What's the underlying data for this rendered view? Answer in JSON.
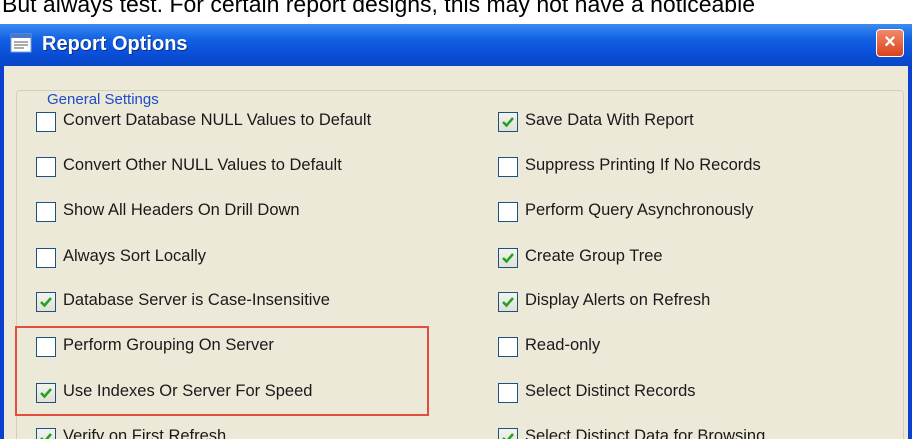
{
  "caption": "But always test.  For certain report designs, this may not have a noticeable",
  "window": {
    "title": "Report Options",
    "close_label": "×"
  },
  "group": {
    "title": "General Settings"
  },
  "options": {
    "left": [
      {
        "label": "Convert Database NULL Values to Default",
        "checked": false
      },
      {
        "label": "Convert Other NULL Values to Default",
        "checked": false
      },
      {
        "label": "Show All Headers On Drill Down",
        "checked": false
      },
      {
        "label": "Always Sort Locally",
        "checked": false
      },
      {
        "label": "Database Server is Case-Insensitive",
        "checked": true
      },
      {
        "label": "Perform Grouping On Server",
        "checked": false
      },
      {
        "label": "Use Indexes Or Server For Speed",
        "checked": true
      },
      {
        "label": "Verify on First Refresh",
        "checked": true
      }
    ],
    "right": [
      {
        "label": "Save Data With Report",
        "checked": true
      },
      {
        "label": "Suppress Printing If No Records",
        "checked": false
      },
      {
        "label": "Perform Query Asynchronously",
        "checked": false
      },
      {
        "label": "Create Group Tree",
        "checked": true
      },
      {
        "label": "Display Alerts on Refresh",
        "checked": true
      },
      {
        "label": "Read-only",
        "checked": false
      },
      {
        "label": "Select Distinct Records",
        "checked": false
      },
      {
        "label": "Select Distinct Data for Browsing",
        "checked": true
      }
    ]
  },
  "colors": {
    "highlight_box": "#e24e3e",
    "title_bar": "#0a4fd8",
    "checkmark": "#21a121"
  }
}
